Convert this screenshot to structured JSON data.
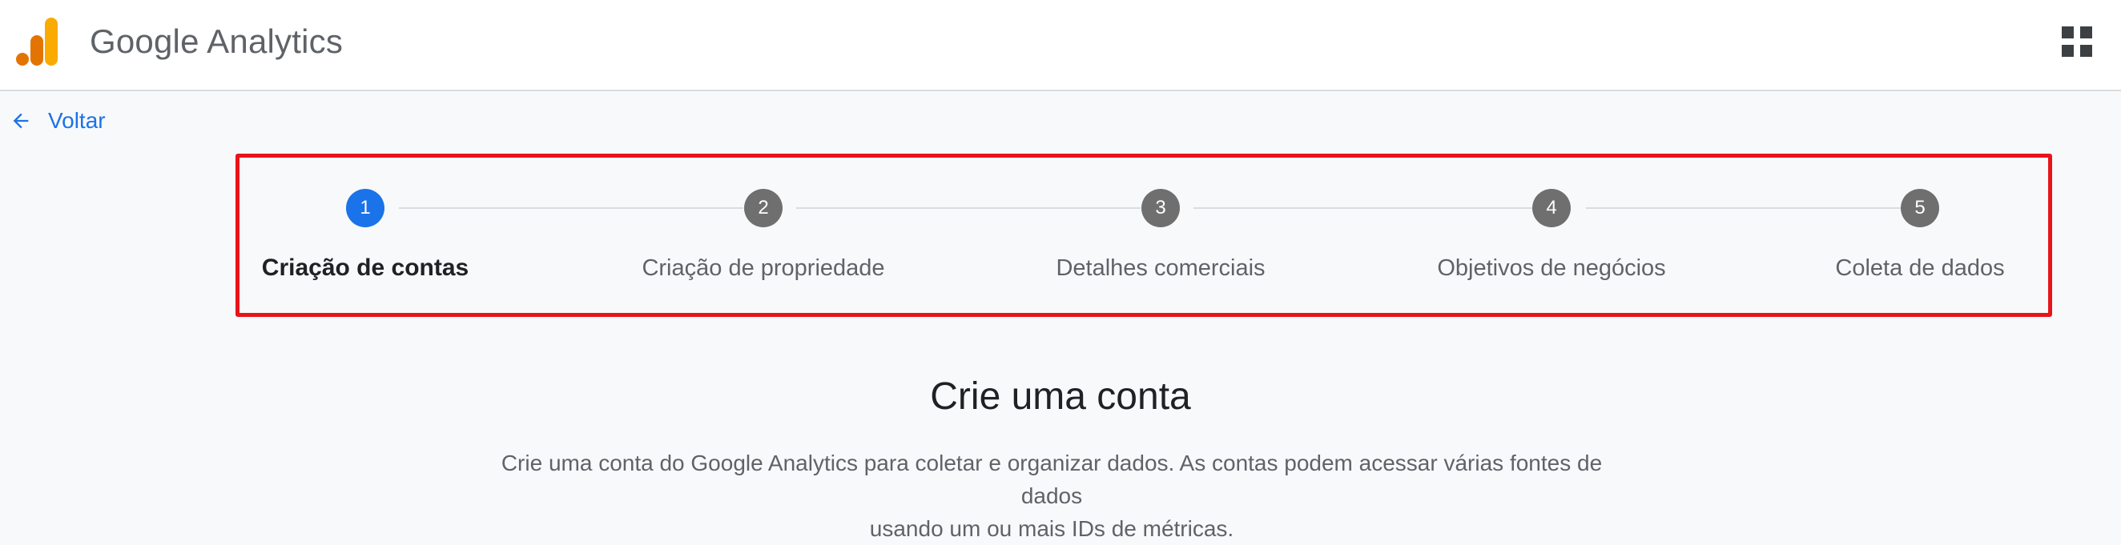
{
  "header": {
    "product_name": "Google Analytics",
    "logo_icon": "google-analytics-logo",
    "apps_icon": "apps-grid-icon",
    "colors": {
      "logo_dark": "#e37400",
      "logo_light": "#f9ab00"
    }
  },
  "back": {
    "label": "Voltar",
    "icon": "arrow-back-icon",
    "color": "#1a73e8"
  },
  "stepper": {
    "highlight_color": "#e8141c",
    "active_color": "#1a73e8",
    "inactive_color": "#6f6f6f",
    "steps": [
      {
        "number": "1",
        "label": "Criação de contas",
        "active": true
      },
      {
        "number": "2",
        "label": "Criação de propriedade",
        "active": false
      },
      {
        "number": "3",
        "label": "Detalhes comerciais",
        "active": false
      },
      {
        "number": "4",
        "label": "Objetivos de negócios",
        "active": false
      },
      {
        "number": "5",
        "label": "Coleta de dados",
        "active": false
      }
    ]
  },
  "main": {
    "title": "Crie uma conta",
    "description_line1": "Crie uma conta do Google Analytics para coletar e organizar dados. As contas podem acessar várias fontes de dados",
    "description_line2": "usando um ou mais IDs de métricas."
  }
}
